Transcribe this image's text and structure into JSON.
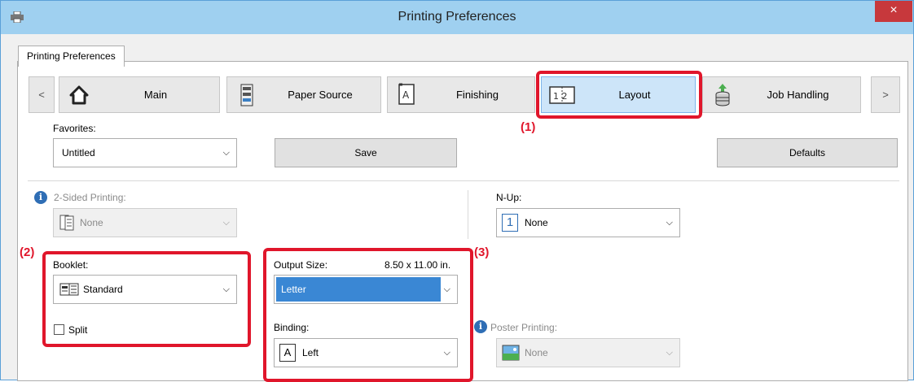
{
  "window": {
    "title": "Printing Preferences",
    "close_glyph": "×"
  },
  "tabs": [
    {
      "label": "Printing Preferences"
    }
  ],
  "nav": {
    "prev": "<",
    "next": ">",
    "buttons": [
      {
        "label": "Main",
        "icon": "home-icon"
      },
      {
        "label": "Paper Source",
        "icon": "paper-tray-icon"
      },
      {
        "label": "Finishing",
        "icon": "finishing-icon"
      },
      {
        "label": "Layout",
        "icon": "layout-icon"
      },
      {
        "label": "Job Handling",
        "icon": "job-handling-icon"
      }
    ],
    "icon_text": {
      "layout": "1 2"
    }
  },
  "favorites": {
    "label": "Favorites:",
    "value": "Untitled",
    "save": "Save",
    "defaults": "Defaults"
  },
  "two_sided": {
    "label": "2-Sided Printing:",
    "value": "None"
  },
  "nup": {
    "label": "N-Up:",
    "value": "None",
    "icon_text": "1"
  },
  "booklet": {
    "label": "Booklet:",
    "value": "Standard",
    "split": "Split"
  },
  "output_size": {
    "label": "Output Size:",
    "size": "8.50 x 11.00 in.",
    "value": "Letter"
  },
  "binding": {
    "label": "Binding:",
    "value": "Left",
    "icon_text": "A"
  },
  "poster": {
    "label": "Poster Printing:",
    "value": "None"
  },
  "callouts": [
    "(1)",
    "(2)",
    "(3)"
  ],
  "colors": {
    "highlight": "#e0162b",
    "selection": "#3a87d4",
    "title_bar": "#9fd0f0"
  }
}
